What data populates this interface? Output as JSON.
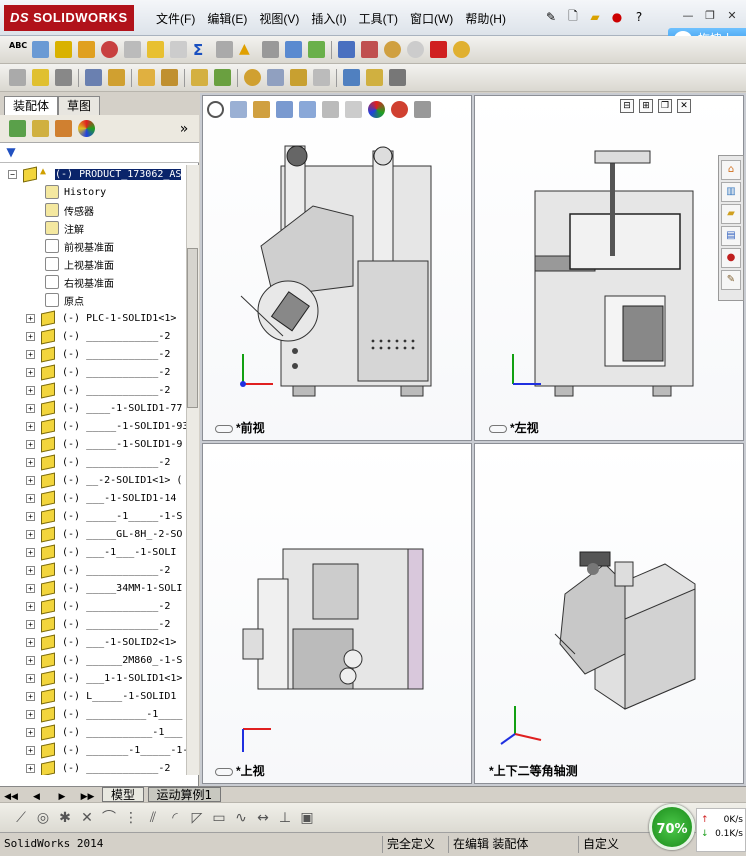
{
  "app": {
    "logo": "SOLIDWORKS",
    "logo_prefix": "DS",
    "menus": [
      "文件(F)",
      "编辑(E)",
      "视图(V)",
      "插入(I)",
      "工具(T)",
      "窗口(W)",
      "帮助(H)"
    ],
    "drag_button": "拖拽上"
  },
  "left_panel": {
    "tabs": [
      "装配体",
      "草图"
    ],
    "root": "(-) PRODUCT_173062_AS",
    "special_items": [
      "History",
      "传感器",
      "注解",
      "前视基准面",
      "上视基准面",
      "右视基准面",
      "原点"
    ],
    "components": [
      "(-) PLC-1-SOLID1<1>",
      "(-) ____________-2",
      "(-) ____________-2",
      "(-) ____________-2",
      "(-) ____________-2",
      "(-) ____-1-SOLID1-77",
      "(-) _____-1-SOLID1-93",
      "(-) _____-1-SOLID1-9",
      "(-) ____________-2",
      "(-) __-2-SOLID1<1> (",
      "(-) ___-1-SOLID1-14",
      "(-) _____-1_____-1-S",
      "(-) _____GL-8H_-2-SO",
      "(-) ___-1___-1-SOLI",
      "(-) ____________-2",
      "(-) _____34MM-1-SOLI",
      "(-) ____________-2",
      "(-) ____________-2",
      "(-) ___-1-SOLID2<1>",
      "(-) ______2M860_-1-S",
      "(-) ___1-1-SOLID1<1>",
      "(-) L_____-1-SOLID1",
      "(-) __________-1____",
      "(-) ___________-1___",
      "(-) _______-1_____-1-S",
      "(-) ____________-2"
    ]
  },
  "viewports": {
    "front": "*前视",
    "left": "*左视",
    "top": "*上视",
    "iso": "*上下二等角轴测"
  },
  "bottom_tabs": [
    "模型",
    "运动算例1"
  ],
  "status": {
    "app_version": "SolidWorks 2014",
    "state": "完全定义",
    "mode": "在编辑 装配体",
    "custom": "自定义"
  },
  "network": {
    "percent": "70%",
    "up": "0K/s",
    "down": "0.1K/s"
  },
  "colors": {
    "brand": "#b1121a",
    "gauge": "#2aa62a",
    "drag_button": "#2b8fe3"
  }
}
